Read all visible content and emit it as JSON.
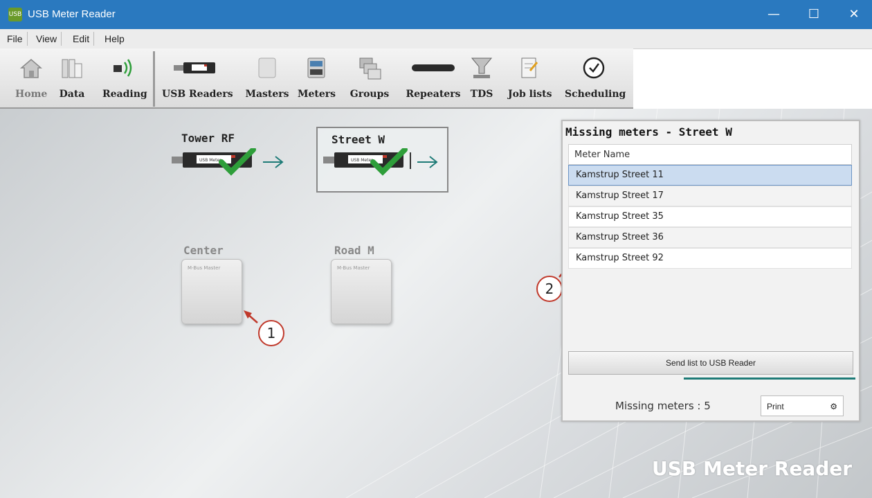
{
  "window": {
    "title": "USB Meter Reader",
    "minimize": "—",
    "maximize": "☐",
    "close": "✕"
  },
  "menu": {
    "items": [
      "File",
      "View",
      "Edit",
      "Help"
    ]
  },
  "toolbar": {
    "tools": [
      {
        "label": "Home",
        "icon": "home-icon",
        "dim": true
      },
      {
        "label": "Data",
        "icon": "data-icon"
      },
      {
        "label": "Reading",
        "icon": "reading-icon"
      },
      {
        "label": "USB Readers",
        "icon": "usb-reader-icon"
      },
      {
        "label": "Masters",
        "icon": "master-icon"
      },
      {
        "label": "Meters",
        "icon": "meter-icon"
      },
      {
        "label": "Groups",
        "icon": "groups-icon"
      },
      {
        "label": "Repeaters",
        "icon": "repeater-icon"
      },
      {
        "label": "TDS",
        "icon": "tds-icon"
      },
      {
        "label": "Job lists",
        "icon": "job-list-icon"
      },
      {
        "label": "Scheduling",
        "icon": "clock-icon"
      }
    ]
  },
  "devices": {
    "tower": {
      "name": "Tower RF",
      "usb_label": "USB Meter"
    },
    "street": {
      "name": "Street W",
      "usb_label": "USB Meter"
    },
    "center": {
      "name": "Center",
      "master_label": "M-Bus Master"
    },
    "road": {
      "name": "Road M",
      "master_label": "M-Bus Master"
    }
  },
  "callouts": {
    "one": "1",
    "two": "2"
  },
  "panel": {
    "title": "Missing meters - Street W",
    "column_header": "Meter Name",
    "rows": [
      "Kamstrup Street 11",
      "Kamstrup Street 17",
      "Kamstrup Street 35",
      "Kamstrup Street 36",
      "Kamstrup Street 92"
    ],
    "send_button": "Send list to USB Reader",
    "missing_count": "Missing meters : 5",
    "print_button": "Print"
  },
  "watermark": "USB Meter Reader",
  "colors": {
    "titlebar": "#2a79bf",
    "selection": "#cbdcf0",
    "progress": "#1e7b77",
    "check": "#2e9e3a",
    "callout_border": "#c0392b"
  }
}
